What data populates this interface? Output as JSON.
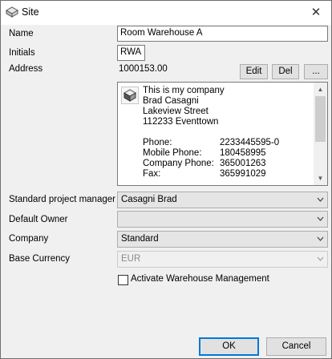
{
  "window": {
    "title": "Site",
    "close_symbol": "✕"
  },
  "labels": {
    "name": "Name",
    "initials": "Initials",
    "address": "Address",
    "standard_pm": "Standard project manager",
    "default_owner": "Default Owner",
    "company": "Company",
    "base_currency": "Base Currency"
  },
  "fields": {
    "name_value": "Room Warehouse A",
    "initials_value": "RWA",
    "address_number": "1000153.00"
  },
  "address_buttons": {
    "edit": "Edit",
    "delete": "Del",
    "more": "..."
  },
  "address_card": {
    "lines": [
      "This is my company",
      "Brad Casagni",
      "Lakeview Street",
      "112233 Eventtown"
    ],
    "contacts": [
      {
        "label": "Phone:",
        "value": "2233445595-0"
      },
      {
        "label": "Mobile Phone:",
        "value": "180458995"
      },
      {
        "label": "Company Phone:",
        "value": "365001263"
      },
      {
        "label": "Fax:",
        "value": "365991029"
      }
    ]
  },
  "dropdowns": {
    "standard_pm": "Casagni Brad",
    "default_owner": "",
    "company": "Standard",
    "base_currency": "EUR"
  },
  "checkbox": {
    "label": "Activate Warehouse Management",
    "checked": false
  },
  "footer": {
    "ok": "OK",
    "cancel": "Cancel"
  },
  "icons": {
    "title": "warehouse-icon",
    "address_card": "building-icon",
    "dropdown": "chevron-down-icon",
    "scroll_up": "arrow-up-icon",
    "scroll_down": "arrow-down-icon"
  }
}
